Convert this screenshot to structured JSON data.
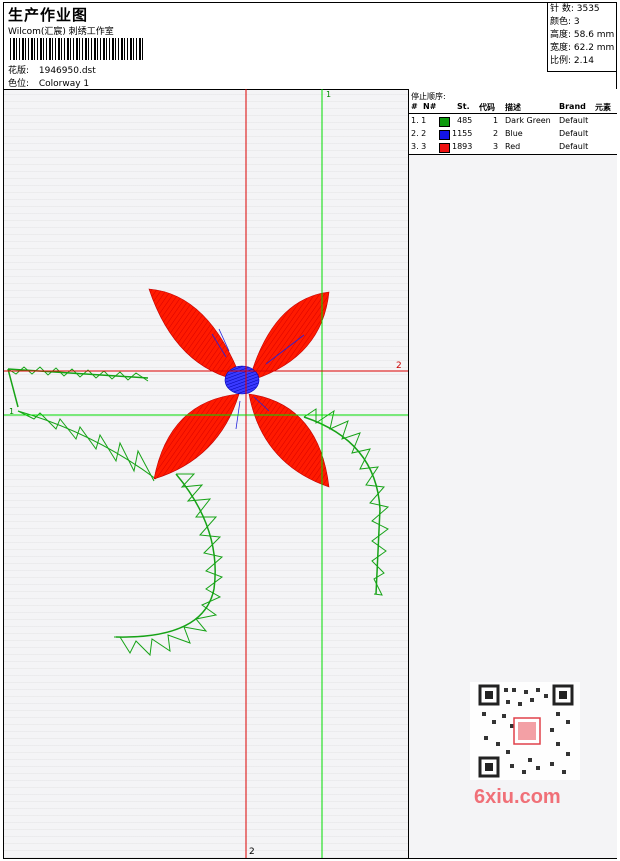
{
  "header": {
    "title": "生产作业图",
    "studio": "Wilcom(汇宸) 刺绣工作室",
    "design_label": "花版:",
    "design_value": "1946950.dst",
    "colorway_label": "色位:",
    "colorway_value": "Colorway 1"
  },
  "stats": {
    "stitches": "针 数: 3535",
    "colors": "颜色: 3",
    "height": "高度: 58.6 mm",
    "width": "宽度: 62.2 mm",
    "scale": "比例: 2.14"
  },
  "stop_sequence": {
    "title": "停止顺序:",
    "columns": [
      "#",
      "N#",
      "St.",
      "代码",
      "描述",
      "Brand",
      "元素"
    ],
    "rows": [
      {
        "n": "1. 1",
        "color": "#0e9a0e",
        "st": "485",
        "code": "1",
        "desc": "Dark Green",
        "brand": "Default"
      },
      {
        "n": "2. 2",
        "color": "#1414e6",
        "st": "1155",
        "code": "2",
        "desc": "Blue",
        "brand": "Default"
      },
      {
        "n": "3. 3",
        "color": "#ee1111",
        "st": "1893",
        "code": "3",
        "desc": "Red",
        "brand": "Default"
      }
    ]
  },
  "guides": {
    "marker_1": "1",
    "marker_2": "2"
  },
  "watermark": {
    "site": "6xiu.com"
  },
  "colors": {
    "green_guide": "#00dd00",
    "red_guide": "#dd0000",
    "petal": "#ff1a00",
    "leaf": "#17a317",
    "center": "#1a1ae0"
  }
}
